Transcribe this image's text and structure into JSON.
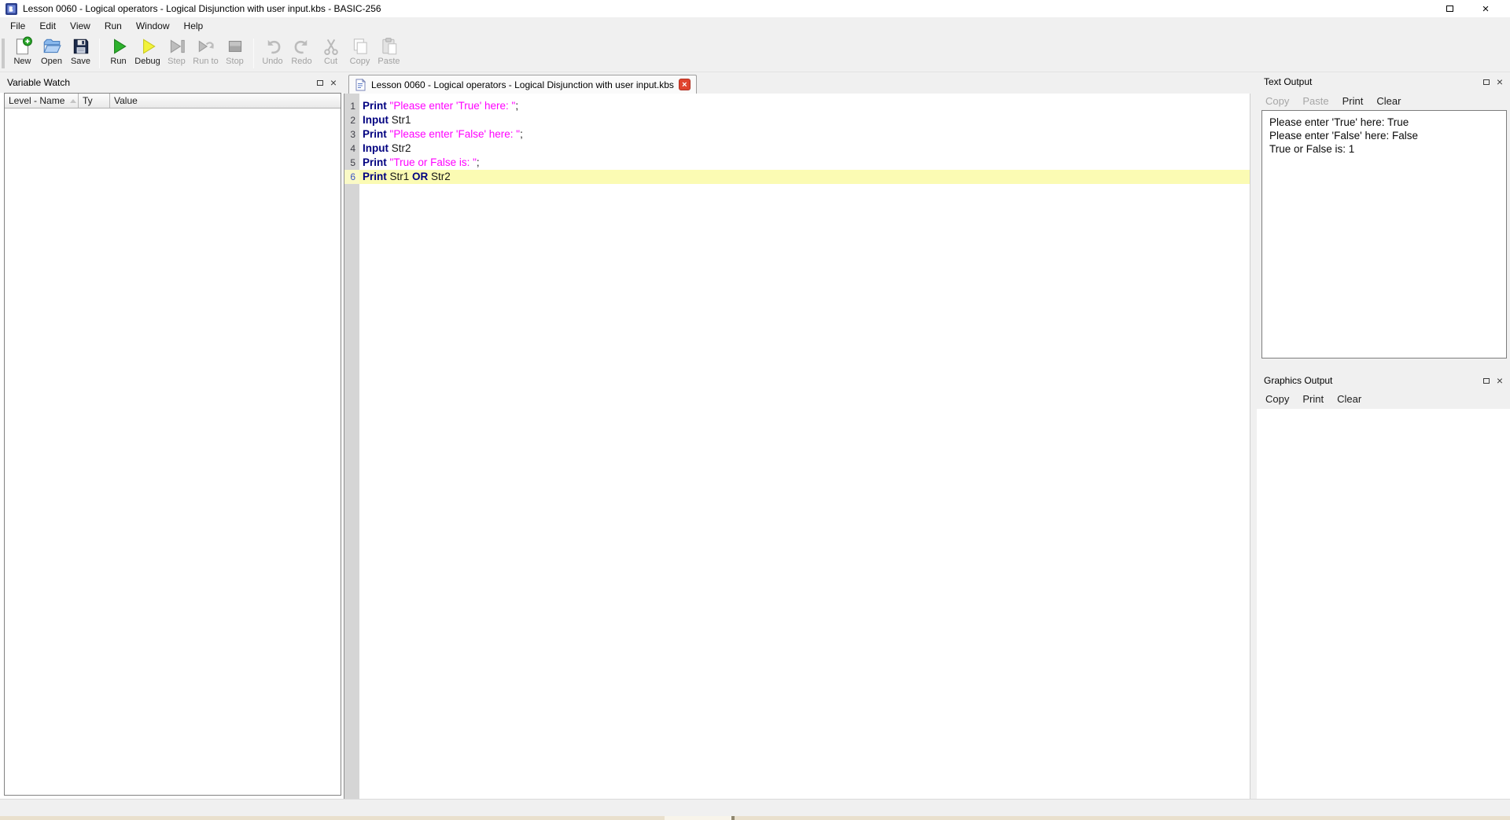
{
  "window": {
    "title": "Lesson 0060 - Logical operators - Logical Disjunction with user input.kbs - BASIC-256",
    "controls": [
      {
        "name": "minimize"
      },
      {
        "name": "restore"
      },
      {
        "name": "close"
      }
    ]
  },
  "menubar": {
    "items": [
      "File",
      "Edit",
      "View",
      "Run",
      "Window",
      "Help"
    ]
  },
  "toolbar": {
    "buttons": [
      {
        "label": "New",
        "icon": "new-file-icon",
        "enabled": true
      },
      {
        "label": "Open",
        "icon": "open-folder-icon",
        "enabled": true
      },
      {
        "label": "Save",
        "icon": "save-icon",
        "enabled": true
      },
      {
        "sep": true
      },
      {
        "label": "Run",
        "icon": "run-icon",
        "enabled": true
      },
      {
        "label": "Debug",
        "icon": "debug-icon",
        "enabled": true
      },
      {
        "label": "Step",
        "icon": "step-icon",
        "enabled": false
      },
      {
        "label": "Run to",
        "icon": "run-to-icon",
        "enabled": false
      },
      {
        "label": "Stop",
        "icon": "stop-icon",
        "enabled": false
      },
      {
        "sep": true
      },
      {
        "label": "Undo",
        "icon": "undo-icon",
        "enabled": false
      },
      {
        "label": "Redo",
        "icon": "redo-icon",
        "enabled": false
      },
      {
        "label": "Cut",
        "icon": "cut-icon",
        "enabled": false
      },
      {
        "label": "Copy",
        "icon": "copy-icon",
        "enabled": false
      },
      {
        "label": "Paste",
        "icon": "paste-icon",
        "enabled": false
      }
    ]
  },
  "variable_watch": {
    "title": "Variable Watch",
    "columns": [
      "Level - Name",
      "Ty",
      "Value"
    ],
    "rows": [],
    "panel_icons": [
      "float-icon",
      "close-icon"
    ]
  },
  "editor": {
    "tab_label": "Lesson 0060 - Logical operators - Logical Disjunction with user input.kbs",
    "lines": [
      {
        "num": "1",
        "highlight": false,
        "tokens": [
          {
            "text": "Print",
            "type": "keyword"
          },
          {
            "text": " ",
            "type": "plain"
          },
          {
            "text": "\"Please enter 'True' here: \"",
            "type": "string"
          },
          {
            "text": ";",
            "type": "plain"
          }
        ]
      },
      {
        "num": "2",
        "highlight": false,
        "tokens": [
          {
            "text": "Input",
            "type": "keyword"
          },
          {
            "text": " Str1",
            "type": "plain"
          }
        ]
      },
      {
        "num": "3",
        "highlight": false,
        "tokens": [
          {
            "text": "Print",
            "type": "keyword"
          },
          {
            "text": " ",
            "type": "plain"
          },
          {
            "text": "\"Please enter 'False' here: \"",
            "type": "string"
          },
          {
            "text": ";",
            "type": "plain"
          }
        ]
      },
      {
        "num": "4",
        "highlight": false,
        "tokens": [
          {
            "text": "Input",
            "type": "keyword"
          },
          {
            "text": " Str2",
            "type": "plain"
          }
        ]
      },
      {
        "num": "5",
        "highlight": false,
        "tokens": [
          {
            "text": "Print",
            "type": "keyword"
          },
          {
            "text": " ",
            "type": "plain"
          },
          {
            "text": "\"True or False is: \"",
            "type": "string"
          },
          {
            "text": ";",
            "type": "plain"
          }
        ]
      },
      {
        "num": "6",
        "highlight": true,
        "tokens": [
          {
            "text": "Print",
            "type": "keyword"
          },
          {
            "text": " Str1 ",
            "type": "plain"
          },
          {
            "text": "OR",
            "type": "keyword"
          },
          {
            "text": " Str2",
            "type": "plain"
          }
        ]
      }
    ]
  },
  "text_output": {
    "title": "Text Output",
    "buttons": [
      {
        "label": "Copy",
        "enabled": false
      },
      {
        "label": "Paste",
        "enabled": false
      },
      {
        "label": "Print",
        "enabled": true
      },
      {
        "label": "Clear",
        "enabled": true
      }
    ],
    "lines": [
      "Please enter 'True' here: True",
      "Please enter 'False' here: False",
      "True or False is: 1"
    ],
    "panel_icons": [
      "float-icon",
      "close-icon"
    ]
  },
  "graphics_output": {
    "title": "Graphics Output",
    "buttons": [
      {
        "label": "Copy",
        "enabled": true
      },
      {
        "label": "Print",
        "enabled": true
      },
      {
        "label": "Clear",
        "enabled": true
      }
    ],
    "panel_icons": [
      "float-icon",
      "close-icon"
    ]
  },
  "colors": {
    "keyword": "#000080",
    "string": "#ff00ff",
    "highlight_line": "#fbfbb3",
    "tab_close_red": "#e0442e",
    "run_green": "#2db22d",
    "debug_yellow": "#f2f23a",
    "chrome": "#f0f0f0"
  }
}
